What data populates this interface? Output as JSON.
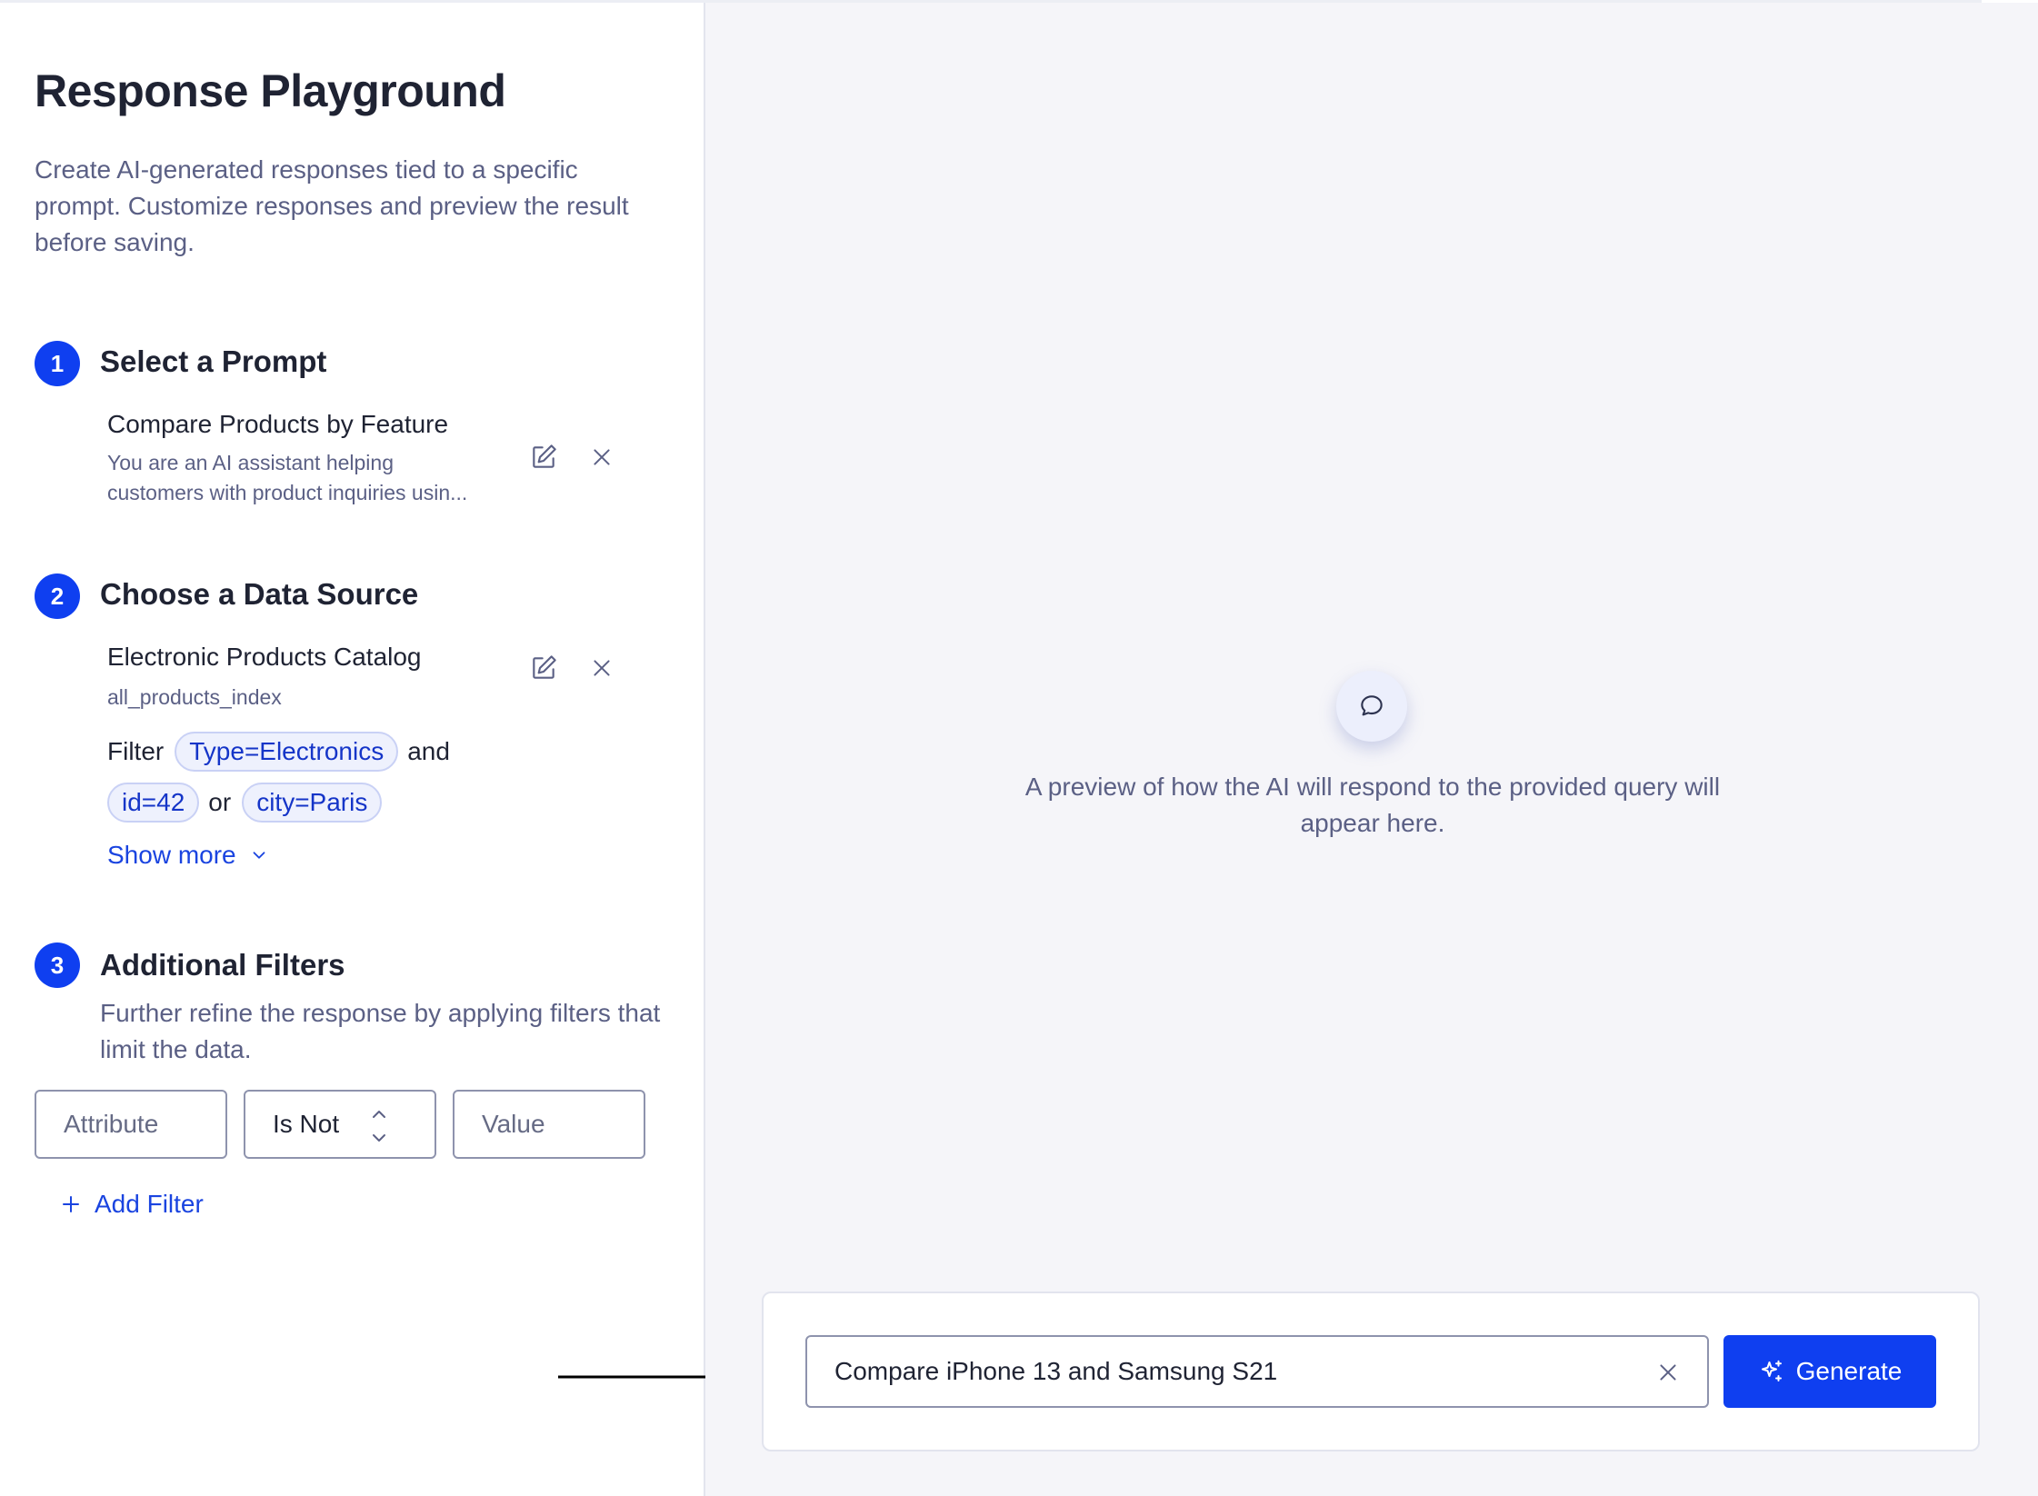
{
  "header": {
    "title": "Response Playground",
    "subtitle": "Create AI-generated responses tied to a specific prompt. Customize responses and preview the result before saving."
  },
  "steps": [
    {
      "number": "1",
      "title": "Select a Prompt"
    },
    {
      "number": "2",
      "title": "Choose a Data Source"
    },
    {
      "number": "3",
      "title": "Additional Filters"
    }
  ],
  "prompt": {
    "name": "Compare Products by Feature",
    "description_line1": "You are an AI assistant helping",
    "description_line2": "customers with product inquiries usin..."
  },
  "data_source": {
    "name": "Electronic Products Catalog",
    "index": "all_products_index",
    "filter_label": "Filter",
    "chips": [
      "Type=Electronics",
      "id=42",
      "city=Paris"
    ],
    "joiners": [
      "and",
      "or"
    ],
    "show_more": "Show more"
  },
  "additional_filters": {
    "description": "Further refine the response by applying filters that limit the data.",
    "attribute_placeholder": "Attribute",
    "operator_value": "Is Not",
    "value_placeholder": "Value",
    "add_filter": "Add Filter"
  },
  "preview": {
    "text": "A preview of how the AI will respond to the provided query will appear here."
  },
  "query": {
    "value": "Compare iPhone 13 and Samsung S21",
    "generate_label": "Generate"
  },
  "colors": {
    "accent": "#0f3ff0",
    "link": "#1a44e0",
    "muted_text": "#5b6085",
    "main_bg": "#f5f5f9"
  },
  "icons": [
    "edit-icon",
    "close-icon",
    "chevron-down-icon",
    "plus-icon",
    "chat-bubble-icon",
    "sparkle-icon",
    "arrow-right-icon",
    "updown-icon"
  ]
}
